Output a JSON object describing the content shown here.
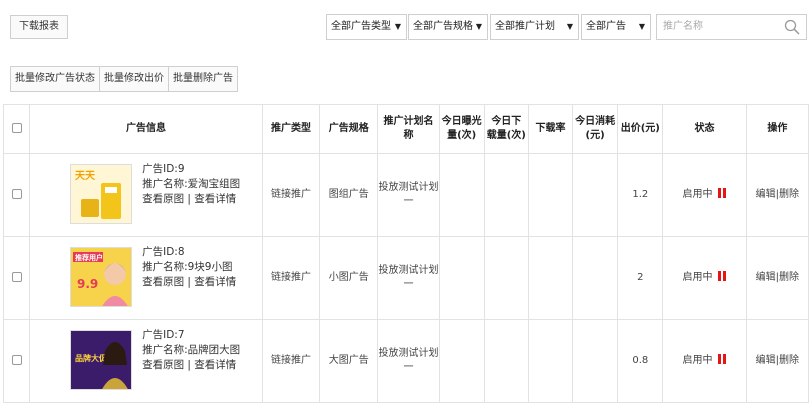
{
  "toolbar": {
    "download_label": "下载报表",
    "filters": [
      {
        "value": "全部广告类型"
      },
      {
        "value": "全部广告规格"
      },
      {
        "value": "全部推广计划"
      },
      {
        "value": "全部广告"
      }
    ],
    "search_placeholder": "推广名称"
  },
  "bulk": {
    "edit_status": "批量修改广告状态",
    "edit_bid": "批量修改出价",
    "delete": "批量删除广告"
  },
  "table": {
    "headers": {
      "info": "广告信息",
      "type": "推广类型",
      "spec": "广告规格",
      "plan": "推广计划名称",
      "impressions": "今日曝光量(次)",
      "downloads": "今日下载量(次)",
      "rate": "下载率",
      "cost": "今日消耗(元)",
      "bid": "出价(元)",
      "status": "状态",
      "ops": "操作"
    },
    "rows": [
      {
        "id": "广告ID:9",
        "name": "推广名称:爱淘宝组图",
        "links": "查看原图 | 查看详情",
        "type": "链接推广",
        "spec": "图组广告",
        "plan": "投放测试计划一",
        "impressions": "",
        "downloads": "",
        "rate": "",
        "cost": "",
        "bid": "1.2",
        "status": "启用中",
        "edit": "编辑",
        "sep": "|",
        "delete": "删除"
      },
      {
        "id": "广告ID:8",
        "name": "推广名称:9块9小图",
        "links": "查看原图 | 查看详情",
        "type": "链接推广",
        "spec": "小图广告",
        "plan": "投放测试计划一",
        "impressions": "",
        "downloads": "",
        "rate": "",
        "cost": "",
        "bid": "2",
        "status": "启用中",
        "edit": "编辑",
        "sep": "|",
        "delete": "删除"
      },
      {
        "id": "广告ID:7",
        "name": "推广名称:品牌团大图",
        "links": "查看原图 | 查看详情",
        "type": "链接推广",
        "spec": "大图广告",
        "plan": "投放测试计划一",
        "impressions": "",
        "downloads": "",
        "rate": "",
        "cost": "",
        "bid": "0.8",
        "status": "启用中",
        "edit": "编辑",
        "sep": "|",
        "delete": "删除"
      }
    ]
  },
  "thumbs": [
    {
      "text": "天天"
    },
    {
      "text": "推荐用户"
    },
    {
      "text": "品牌大促"
    }
  ],
  "colors": {
    "pause": "#e41515",
    "border": "#e2e2e2"
  }
}
